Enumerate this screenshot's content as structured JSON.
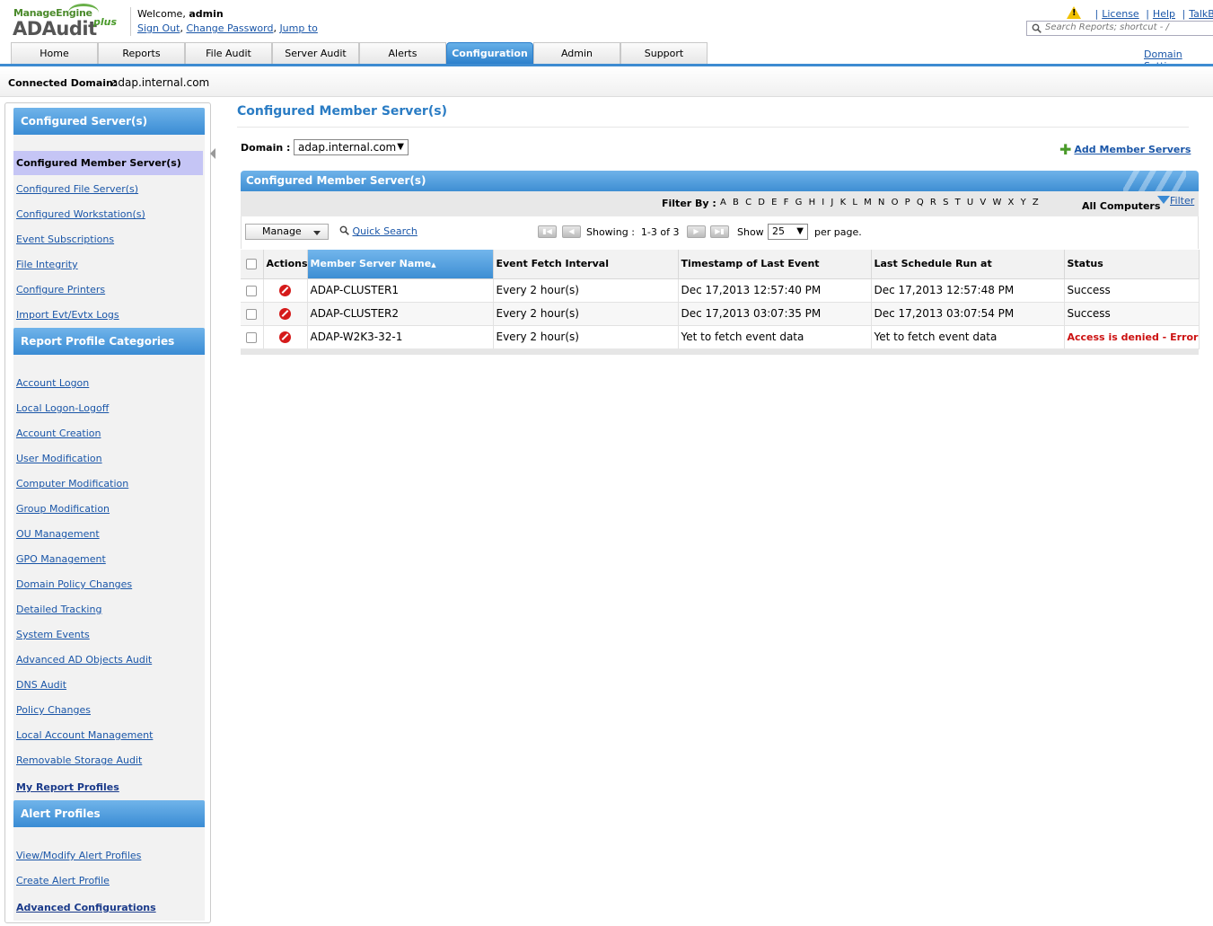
{
  "header": {
    "brand_top": "ManageEngine",
    "brand_main": "ADAudit",
    "brand_plus": "plus",
    "welcome_prefix": "Welcome,",
    "username": "admin",
    "sign_out": "Sign Out",
    "change_password": "Change Password",
    "jump_to": "Jump to",
    "license": "License",
    "help": "Help",
    "talkback": "TalkBa",
    "search_placeholder": "Search Reports; shortcut - /",
    "domain_settings": "Domain Settin"
  },
  "tabs": [
    {
      "label": "Home"
    },
    {
      "label": "Reports"
    },
    {
      "label": "File Audit"
    },
    {
      "label": "Server Audit"
    },
    {
      "label": "Alerts"
    },
    {
      "label": "Configuration",
      "active": true
    },
    {
      "label": "Admin"
    },
    {
      "label": "Support"
    }
  ],
  "connected": {
    "label": "Connected Domain:",
    "value": "adap.internal.com"
  },
  "sidebar": {
    "sec1_title": "Configured Server(s)",
    "selected": "Configured Member Server(s)",
    "sec1_items": [
      "Configured File Server(s)",
      "Configured Workstation(s)",
      "Event Subscriptions",
      "File Integrity",
      "Configure Printers",
      "Import Evt/Evtx Logs"
    ],
    "sec2_title": "Report Profile Categories",
    "sec2_items": [
      "Account Logon",
      "Local Logon-Logoff",
      "Account Creation",
      "User Modification",
      "Computer Modification",
      "Group Modification",
      "OU Management",
      "GPO Management",
      "Domain Policy Changes",
      "Detailed Tracking",
      "System Events",
      "Advanced AD Objects Audit",
      "DNS Audit",
      "Policy Changes",
      "Local Account Management",
      "Removable Storage Audit"
    ],
    "my_report_profiles": "My Report Profiles",
    "sec3_title": "Alert Profiles",
    "sec3_items": [
      "View/Modify Alert Profiles",
      "Create Alert Profile"
    ],
    "advanced_config": "Advanced Configurations"
  },
  "main": {
    "title": "Configured Member Server(s)",
    "domain_label": "Domain :",
    "domain_value": "adap.internal.com",
    "add_member": "Add Member Servers",
    "grid_title": "Configured Member Server(s)",
    "filter_by": "Filter By :",
    "letters": [
      "A",
      "B",
      "C",
      "D",
      "E",
      "F",
      "G",
      "H",
      "I",
      "J",
      "K",
      "L",
      "M",
      "N",
      "O",
      "P",
      "Q",
      "R",
      "S",
      "T",
      "U",
      "V",
      "W",
      "X",
      "Y",
      "Z"
    ],
    "all_computers": "All Computers",
    "filter_link": "Filter",
    "manage": "Manage",
    "quick_search": "Quick Search",
    "showing_label": "Showing :",
    "showing_value": "1-3 of 3",
    "show_label": "Show",
    "show_value": "25",
    "per_page": "per page."
  },
  "table": {
    "columns": [
      "",
      "Actions",
      "Member Server Name",
      "Event Fetch Interval",
      "Timestamp of Last Event",
      "Last Schedule Run at",
      "Status"
    ],
    "rows": [
      {
        "name": "ADAP-CLUSTER1",
        "interval": "Every 2 hour(s)",
        "last_event": "Dec 17,2013 12:57:40 PM",
        "last_run": "Dec 17,2013 12:57:48 PM",
        "status": "Success",
        "status_color": "#000000"
      },
      {
        "name": "ADAP-CLUSTER2",
        "interval": "Every 2 hour(s)",
        "last_event": "Dec 17,2013 03:07:35 PM",
        "last_run": "Dec 17,2013 03:07:54 PM",
        "status": "Success",
        "status_color": "#000000"
      },
      {
        "name": "ADAP-W2K3-32-1",
        "interval": "Every 2 hour(s)",
        "last_event": "Yet to fetch event data",
        "last_run": "Yet to fetch event data",
        "status": "Access is denied - Error ..",
        "status_color": "#cc1111"
      }
    ]
  },
  "colors": {
    "accent": "#3d8bd1",
    "selected_item": "#c5c5f5",
    "error": "#cc1111"
  }
}
